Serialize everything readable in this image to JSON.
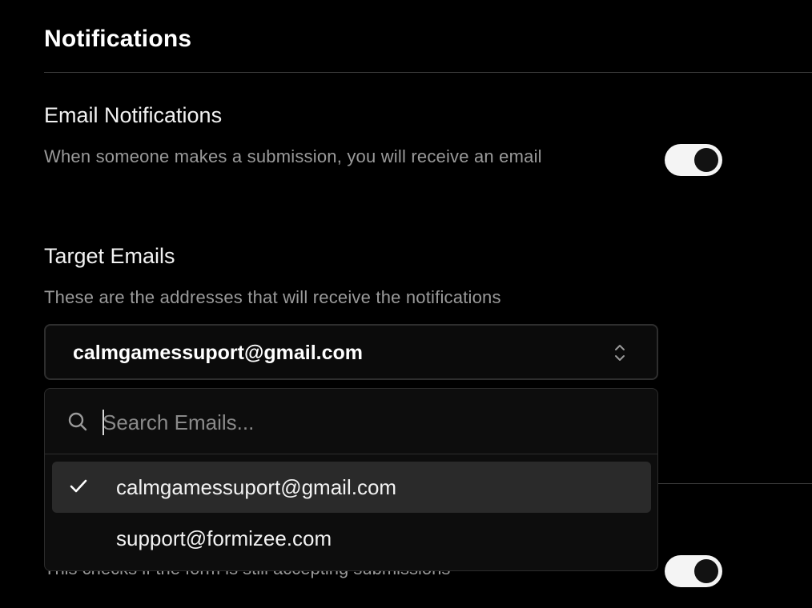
{
  "page": {
    "title": "Notifications"
  },
  "email_notifications": {
    "title": "Email Notifications",
    "description": "When someone makes a submission, you will receive an email",
    "enabled": true
  },
  "target_emails": {
    "title": "Target Emails",
    "description": "These are the addresses that will receive the notifications",
    "selected": "calmgamessuport@gmail.com",
    "search_placeholder": "Search Emails...",
    "options": [
      {
        "label": "calmgamessuport@gmail.com",
        "selected": true
      },
      {
        "label": "support@formizee.com",
        "selected": false
      }
    ]
  },
  "accepting_submissions": {
    "description": "This checks if the form is still accepting submissions",
    "enabled": true
  },
  "icons": {
    "search": "search-icon",
    "chevron": "chevron-up-down-icon",
    "check": "check-icon"
  },
  "colors": {
    "background": "#000000",
    "text": "#f2f2f2",
    "muted": "#9a9a9a",
    "toggle_on": "#f4f4f4",
    "selected_row": "#2a2a2a"
  }
}
